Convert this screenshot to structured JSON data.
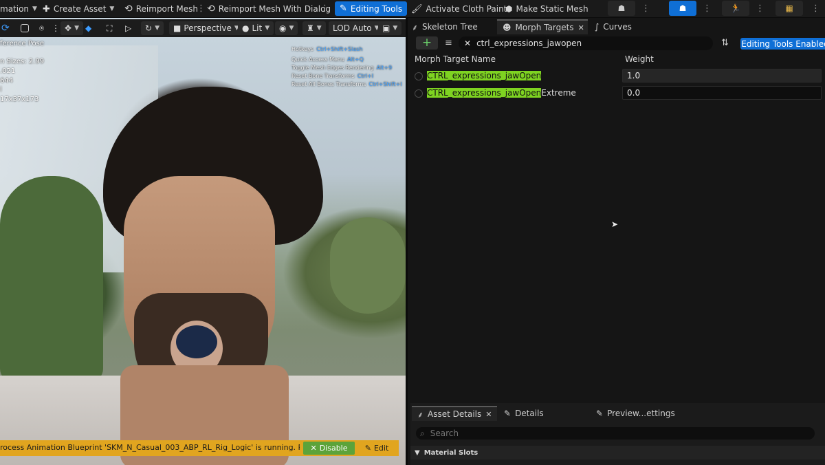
{
  "toolbar": {
    "animation_label": "mation",
    "create_asset_label": "Create Asset",
    "reimport_mesh_label": "Reimport Mesh",
    "reimport_dialog_label": "Reimport Mesh With Dialog",
    "editing_tools_label": "Editing Tools",
    "activate_cloth_label": "Activate Cloth Paint",
    "make_static_label": "Make Static Mesh"
  },
  "viewport": {
    "view_mode": "Perspective",
    "lighting_mode": "Lit",
    "lod_label": "LOD Auto",
    "stats": [
      "ference Pose",
      "n Sizes: 2.99",
      ".021",
      "644",
      "l",
      "17x37x173"
    ],
    "hotkeys": [
      {
        "label": "Hotkeys",
        "key": "Ctrl+Shift+Slash"
      },
      {
        "label": "Quick Access Menu",
        "key": "Alt+Q"
      },
      {
        "label": "Toggle Mesh Edges Rendering",
        "key": "Alt+9"
      },
      {
        "label": "Reset Bone Transforms",
        "key": "Ctrl+I"
      },
      {
        "label": "Reset All Bones Transforms",
        "key": "Ctrl+Shift+I"
      }
    ],
    "notification": "rocess Animation Blueprint 'SKM_N_Casual_003_ABP_RL_Rig_Logic' is running. Post proce",
    "disable_label": "Disable",
    "edit_label": "Edit"
  },
  "right_panel": {
    "tabs": [
      "Skeleton Tree",
      "Morph Targets",
      "Curves"
    ],
    "search_value": "ctrl_expressions_jawopen",
    "editing_enabled_label": "Editing Tools Enabled",
    "columns": [
      "Morph Target Name",
      "Weight"
    ],
    "rows": [
      {
        "highlight": "CTRL_expressions_jawOpen",
        "suffix": "",
        "weight": "1.0"
      },
      {
        "highlight": "CTRL_expressions_jawOpen",
        "suffix": "Extreme",
        "weight": "0.0"
      }
    ],
    "bottom_tabs": [
      "Asset Details",
      "Details",
      "Preview...ettings"
    ],
    "bottom_search_placeholder": "Search",
    "material_slots_label": "Material Slots"
  },
  "colors": {
    "accent_blue": "#0f6fd6",
    "highlight_green": "#7ed321",
    "notification_yellow": "#e1a51f",
    "disable_green": "#5ca33a"
  }
}
